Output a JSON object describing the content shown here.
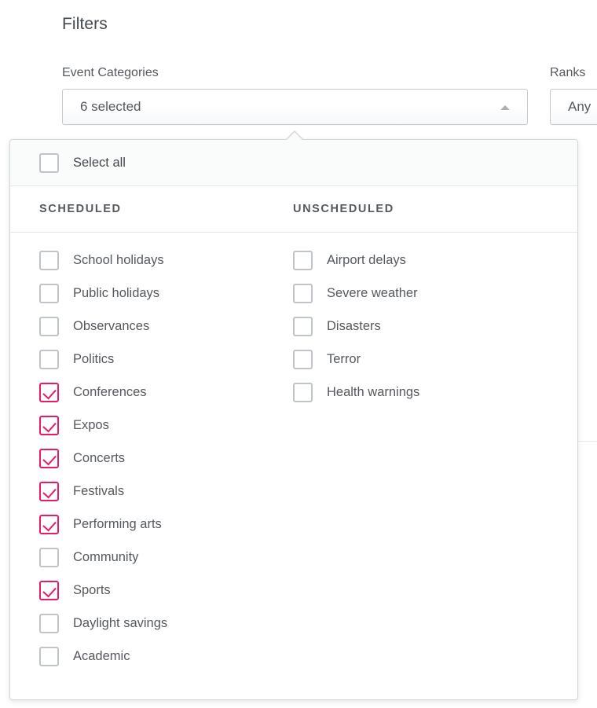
{
  "page": {
    "title": "Filters"
  },
  "filters": {
    "event_categories": {
      "label": "Event Categories",
      "value": "6 selected",
      "caret_icon": "caret-up-icon",
      "expanded": true
    },
    "ranks": {
      "label": "Ranks",
      "value": "Any"
    }
  },
  "dropdown": {
    "select_all": {
      "label": "Select all",
      "checked": false
    },
    "columns": [
      {
        "header": "SCHEDULED",
        "options": [
          {
            "label": "School holidays",
            "checked": false
          },
          {
            "label": "Public holidays",
            "checked": false
          },
          {
            "label": "Observances",
            "checked": false
          },
          {
            "label": "Politics",
            "checked": false
          },
          {
            "label": "Conferences",
            "checked": true
          },
          {
            "label": "Expos",
            "checked": true
          },
          {
            "label": "Concerts",
            "checked": true
          },
          {
            "label": "Festivals",
            "checked": true
          },
          {
            "label": "Performing arts",
            "checked": true
          },
          {
            "label": "Community",
            "checked": false
          },
          {
            "label": "Sports",
            "checked": true
          },
          {
            "label": "Daylight savings",
            "checked": false
          },
          {
            "label": "Academic",
            "checked": false
          }
        ]
      },
      {
        "header": "UNSCHEDULED",
        "options": [
          {
            "label": "Airport delays",
            "checked": false
          },
          {
            "label": "Severe weather",
            "checked": false
          },
          {
            "label": "Disasters",
            "checked": false
          },
          {
            "label": "Terror",
            "checked": false
          },
          {
            "label": "Health warnings",
            "checked": false
          }
        ]
      }
    ]
  },
  "colors": {
    "accent_checked": "#ea1a66",
    "checkbox_border": "#bec4ca",
    "text": "#55595e",
    "border": "#d3d7db"
  }
}
